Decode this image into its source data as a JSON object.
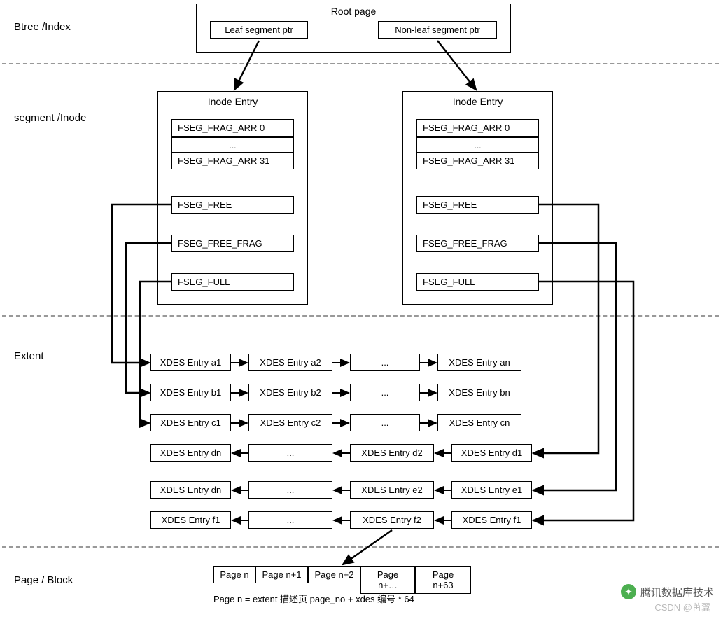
{
  "labels": {
    "btree": "Btree /Index",
    "segment": "segment /Inode",
    "extent": "Extent",
    "page": "Page / Block"
  },
  "root": {
    "title": "Root page",
    "leaf": "Leaf segment ptr",
    "nonleaf": "Non-leaf segment ptr"
  },
  "inode": {
    "title_left": "Inode Entry",
    "title_right": "Inode Entry",
    "frag0": "FSEG_FRAG_ARR 0",
    "frag_dots": "...",
    "frag31": "FSEG_FRAG_ARR 31",
    "free": "FSEG_FREE",
    "free_frag": "FSEG_FREE_FRAG",
    "full": "FSEG_FULL"
  },
  "xdes": {
    "a1": "XDES Entry a1",
    "a2": "XDES Entry  a2",
    "an": "XDES Entry an",
    "b1": "XDES Entry b1",
    "b2": "XDES Entry  b2",
    "bn": "XDES Entry bn",
    "c1": "XDES Entry c1",
    "c2": "XDES Entry  c2",
    "cn": "XDES Entry cn",
    "d1": "XDES Entry d1",
    "d2": "XDES Entry  d2",
    "dn": "XDES Entry dn",
    "e1": "XDES Entry e1",
    "e2": "XDES Entry  e2",
    "edn": "XDES Entry dn",
    "f1a": "XDES Entry f1",
    "f2": "XDES Entry  f2",
    "f1b": "XDES Entry f1",
    "dots": "..."
  },
  "pages": {
    "p0": "Page n",
    "p1": "Page n+1",
    "p2": "Page n+2",
    "p3": "Page n+…",
    "p4": "Page n+63"
  },
  "formula": "Page n = extent 描述页 page_no + xdes 编号 * 64",
  "watermark1": "腾讯数据库技术",
  "watermark2": "CSDN @苒翼"
}
